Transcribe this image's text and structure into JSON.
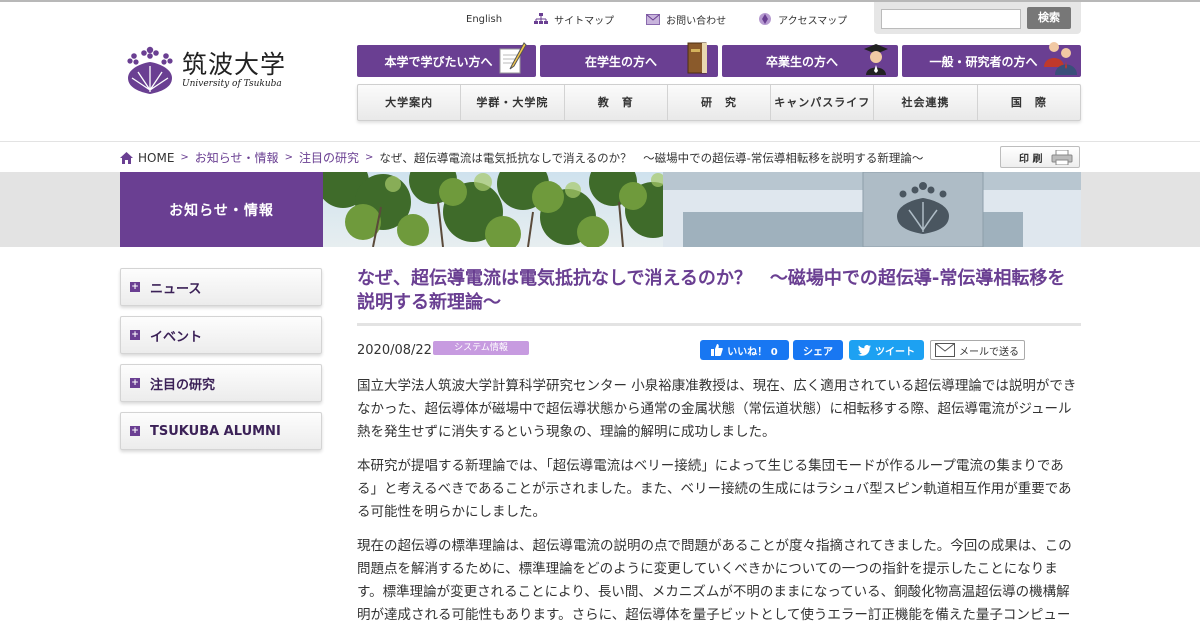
{
  "utility_nav": {
    "english": "English",
    "sitemap": "サイトマップ",
    "contact": "お問い合わせ",
    "access": "アクセスマップ"
  },
  "search": {
    "placeholder": "",
    "button": "検索"
  },
  "logo": {
    "jp": "筑波大学",
    "en": "University of Tsukuba"
  },
  "audience_nav": [
    {
      "label": "本学で学びたい方へ"
    },
    {
      "label": "在学生の方へ"
    },
    {
      "label": "卒業生の方へ"
    },
    {
      "label": "一般・研究者の方へ"
    }
  ],
  "global_nav": [
    {
      "label": "大学案内"
    },
    {
      "label": "学群・大学院"
    },
    {
      "label": "教　育"
    },
    {
      "label": "研　究"
    },
    {
      "label": "キャンパスライフ"
    },
    {
      "label": "社会連携"
    },
    {
      "label": "国　際"
    }
  ],
  "breadcrumb": {
    "home": "HOME",
    "items": [
      "お知らせ・情報",
      "注目の研究"
    ],
    "current": "なぜ、超伝導電流は電気抵抗なしで消えるのか？　〜磁場中での超伝導-常伝導相転移を説明する新理論〜"
  },
  "print_label": "印 刷",
  "banner": {
    "title": "お知らせ・情報"
  },
  "sidebar": {
    "items": [
      {
        "label": "ニュース"
      },
      {
        "label": "イベント"
      },
      {
        "label": "注目の研究"
      },
      {
        "label": "TSUKUBA ALUMNI"
      }
    ]
  },
  "article": {
    "title": "なぜ、超伝導電流は電気抵抗なしで消えるのか？　〜磁場中での超伝導-常伝導相転移を説明する新理論〜",
    "date": "2020/08/22",
    "tag": "システム情報",
    "share": {
      "like": "いいね！ 0",
      "share": "シェア",
      "tweet": "ツイート",
      "mail": "メールで送る"
    },
    "paragraphs": [
      "国立大学法人筑波大学計算科学研究センター 小泉裕康准教授は、現在、広く適用されている超伝導理論では説明ができなかった、超伝導体が磁場中で超伝導状態から通常の金属状態（常伝道状態）に相転移する際、超伝導電流がジュール熱を発生せずに消失するという現象の、理論的解明に成功しました。",
      "本研究が提唱する新理論では、「超伝導電流はベリー接続」によって生じる集団モードが作るループ電流の集まりである」と考えるべきであることが示されました。また、ベリー接続の生成にはラシュバ型スピン軌道相互作用が重要である可能性を明らかにしました。",
      "現在の超伝導の標準理論は、超伝導電流の説明の点で問題があることが度々指摘されてきました。今回の成果は、この問題点を解消するために、標準理論をどのように変更していくべきかについての一つの指針を提示したことになります。標準理論が変更されることにより、長い間、メカニズムが不明のままになっている、銅酸化物高温超伝導の機構解明が達成される可能性もあります。さらに、超伝導体を量子ビットとして使うエラー訂正機能を備えた量子コンピュータの実現に向けた重要な示唆を与える可能性もあります。"
    ]
  },
  "colors": {
    "brand_purple": "#6a3f92",
    "tag_purple": "#c79be0",
    "facebook": "#1877f2",
    "twitter": "#1da1f2"
  },
  "icons": [
    "sitemap-icon",
    "mail-icon",
    "map-icon",
    "pencil-icon",
    "book-icon",
    "graduate-icon",
    "people-icon",
    "home-icon",
    "printer-icon",
    "paulownia-crest-icon",
    "facebook-icon",
    "twitter-icon",
    "envelope-icon",
    "plus-icon"
  ]
}
